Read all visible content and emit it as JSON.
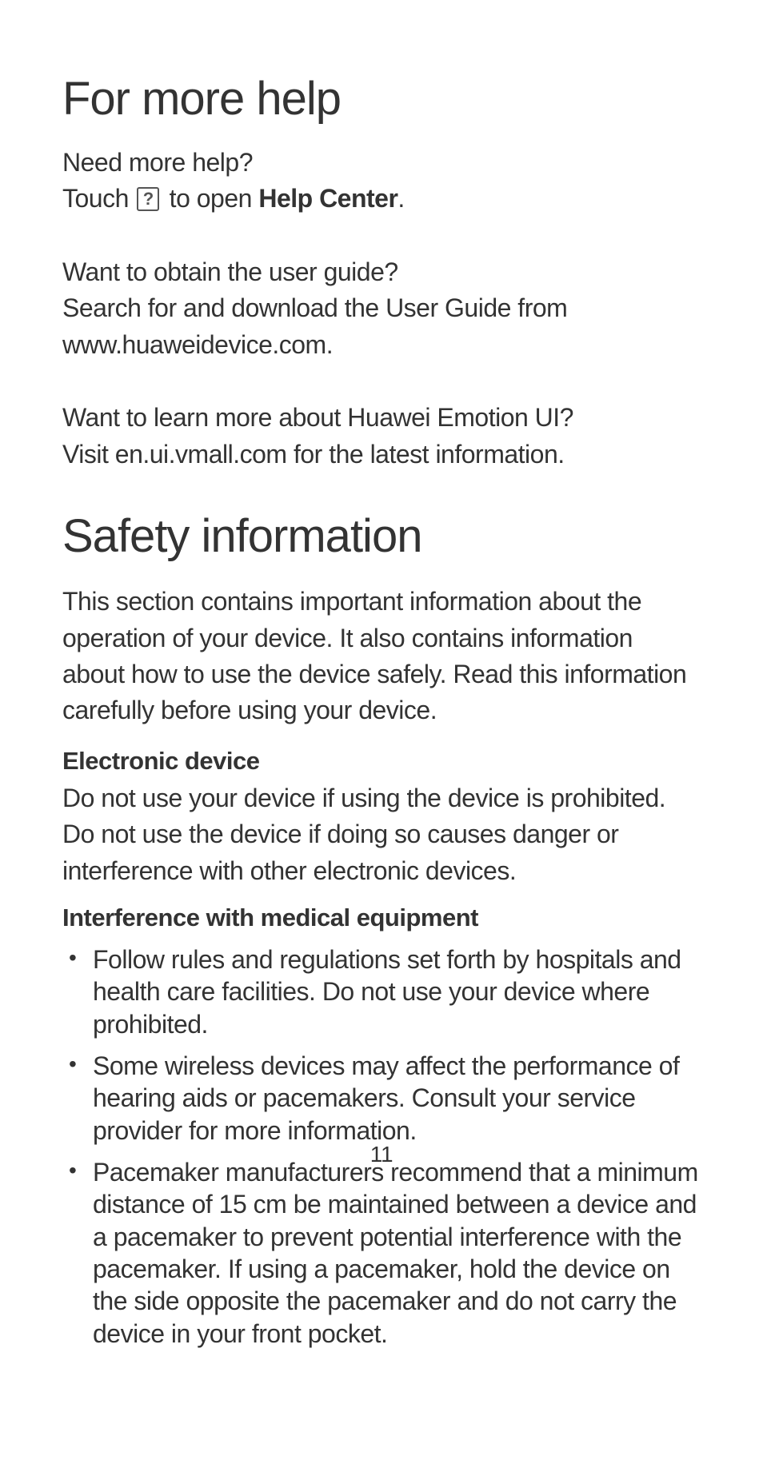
{
  "help": {
    "heading": "For more help",
    "p1_q": "Need more help?",
    "p1_touch": "Touch ",
    "p1_toopen": " to open ",
    "p1_helpcenter": "Help Center",
    "p1_period": ".",
    "p2_q": "Want to obtain the user guide?",
    "p2_body": "Search for and download the User Guide from www.huaweidevice.com.",
    "p3_q": "Want to learn more about Huawei Emotion UI?",
    "p3_body": "Visit en.ui.vmall.com for the latest information."
  },
  "safety": {
    "heading": "Safety information",
    "intro": "This section contains important information about the operation of your device. It also contains information about how to use the device safely. Read this information carefully before using your device.",
    "sub1": "Electronic device",
    "sub1_body": "Do not use your device if using the device is prohibited. Do not use the device if doing so causes danger or interference with other electronic devices.",
    "sub2": "Interference with medical equipment",
    "bullets": [
      "Follow rules and regulations set forth by hospitals and health care facilities. Do not use your device where prohibited.",
      "Some wireless devices may affect the performance of hearing aids or pacemakers. Consult your service provider for more information.",
      "Pacemaker manufacturers recommend that a minimum distance of 15 cm be maintained between a device and a pacemaker to prevent potential interference with the pacemaker. If using a pacemaker, hold the device on the side opposite the pacemaker and do not carry the device in your front pocket."
    ]
  },
  "pagenum": "11"
}
